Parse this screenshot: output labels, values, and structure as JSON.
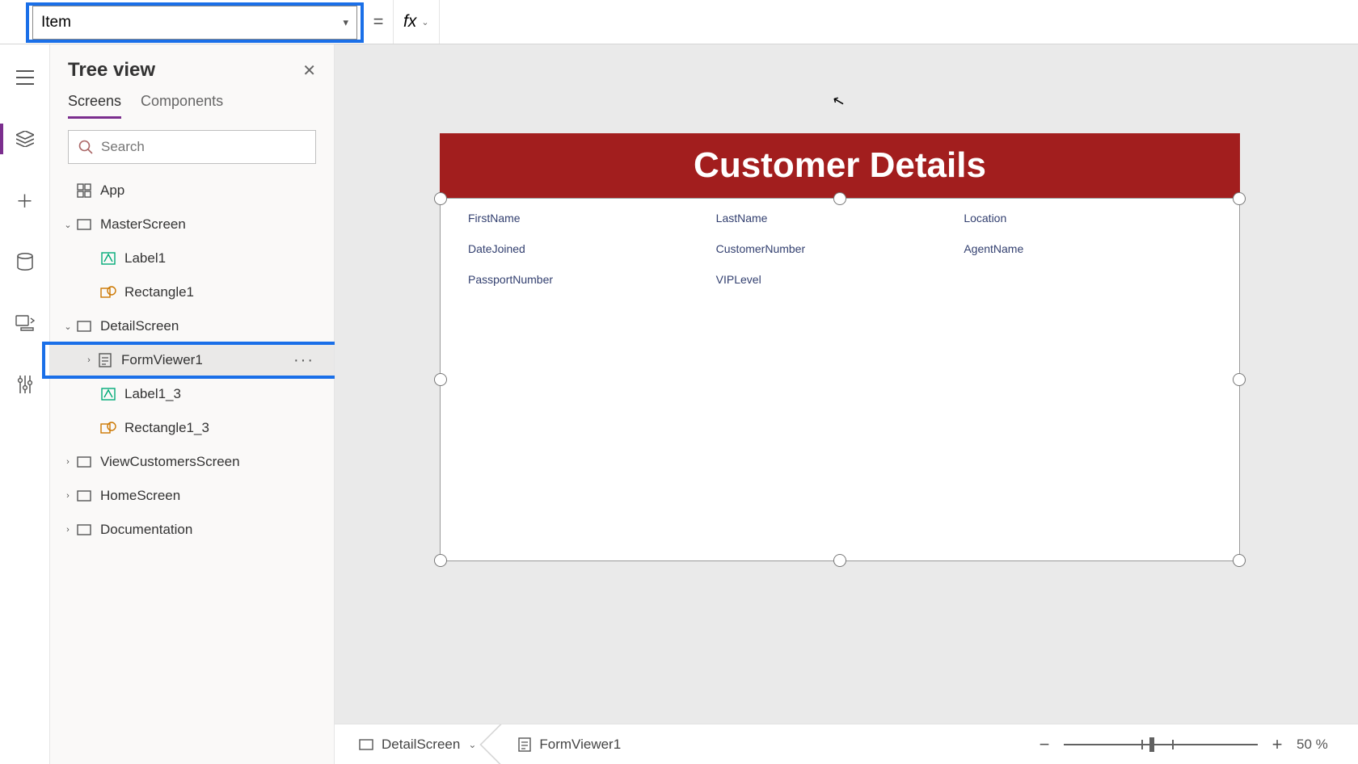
{
  "property_selector": {
    "value": "Item"
  },
  "formula_bar": {
    "eq": "=",
    "fx": "fx"
  },
  "tree": {
    "title": "Tree view",
    "tabs": {
      "screens": "Screens",
      "components": "Components"
    },
    "search_placeholder": "Search",
    "items": {
      "app": "App",
      "master": "MasterScreen",
      "master_label1": "Label1",
      "master_rect1": "Rectangle1",
      "detail": "DetailScreen",
      "detail_form": "FormViewer1",
      "detail_label13": "Label1_3",
      "detail_rect13": "Rectangle1_3",
      "viewcust": "ViewCustomersScreen",
      "home": "HomeScreen",
      "docs": "Documentation"
    },
    "more": "···"
  },
  "canvas": {
    "header": "Customer Details",
    "fields": {
      "r0c0": "FirstName",
      "r0c1": "LastName",
      "r0c2": "Location",
      "r1c0": "DateJoined",
      "r1c1": "CustomerNumber",
      "r1c2": "AgentName",
      "r2c0": "PassportNumber",
      "r2c1": "VIPLevel"
    }
  },
  "breadcrumb": {
    "screen": "DetailScreen",
    "control": "FormViewer1"
  },
  "zoom": {
    "value": "50",
    "pct": "%"
  }
}
